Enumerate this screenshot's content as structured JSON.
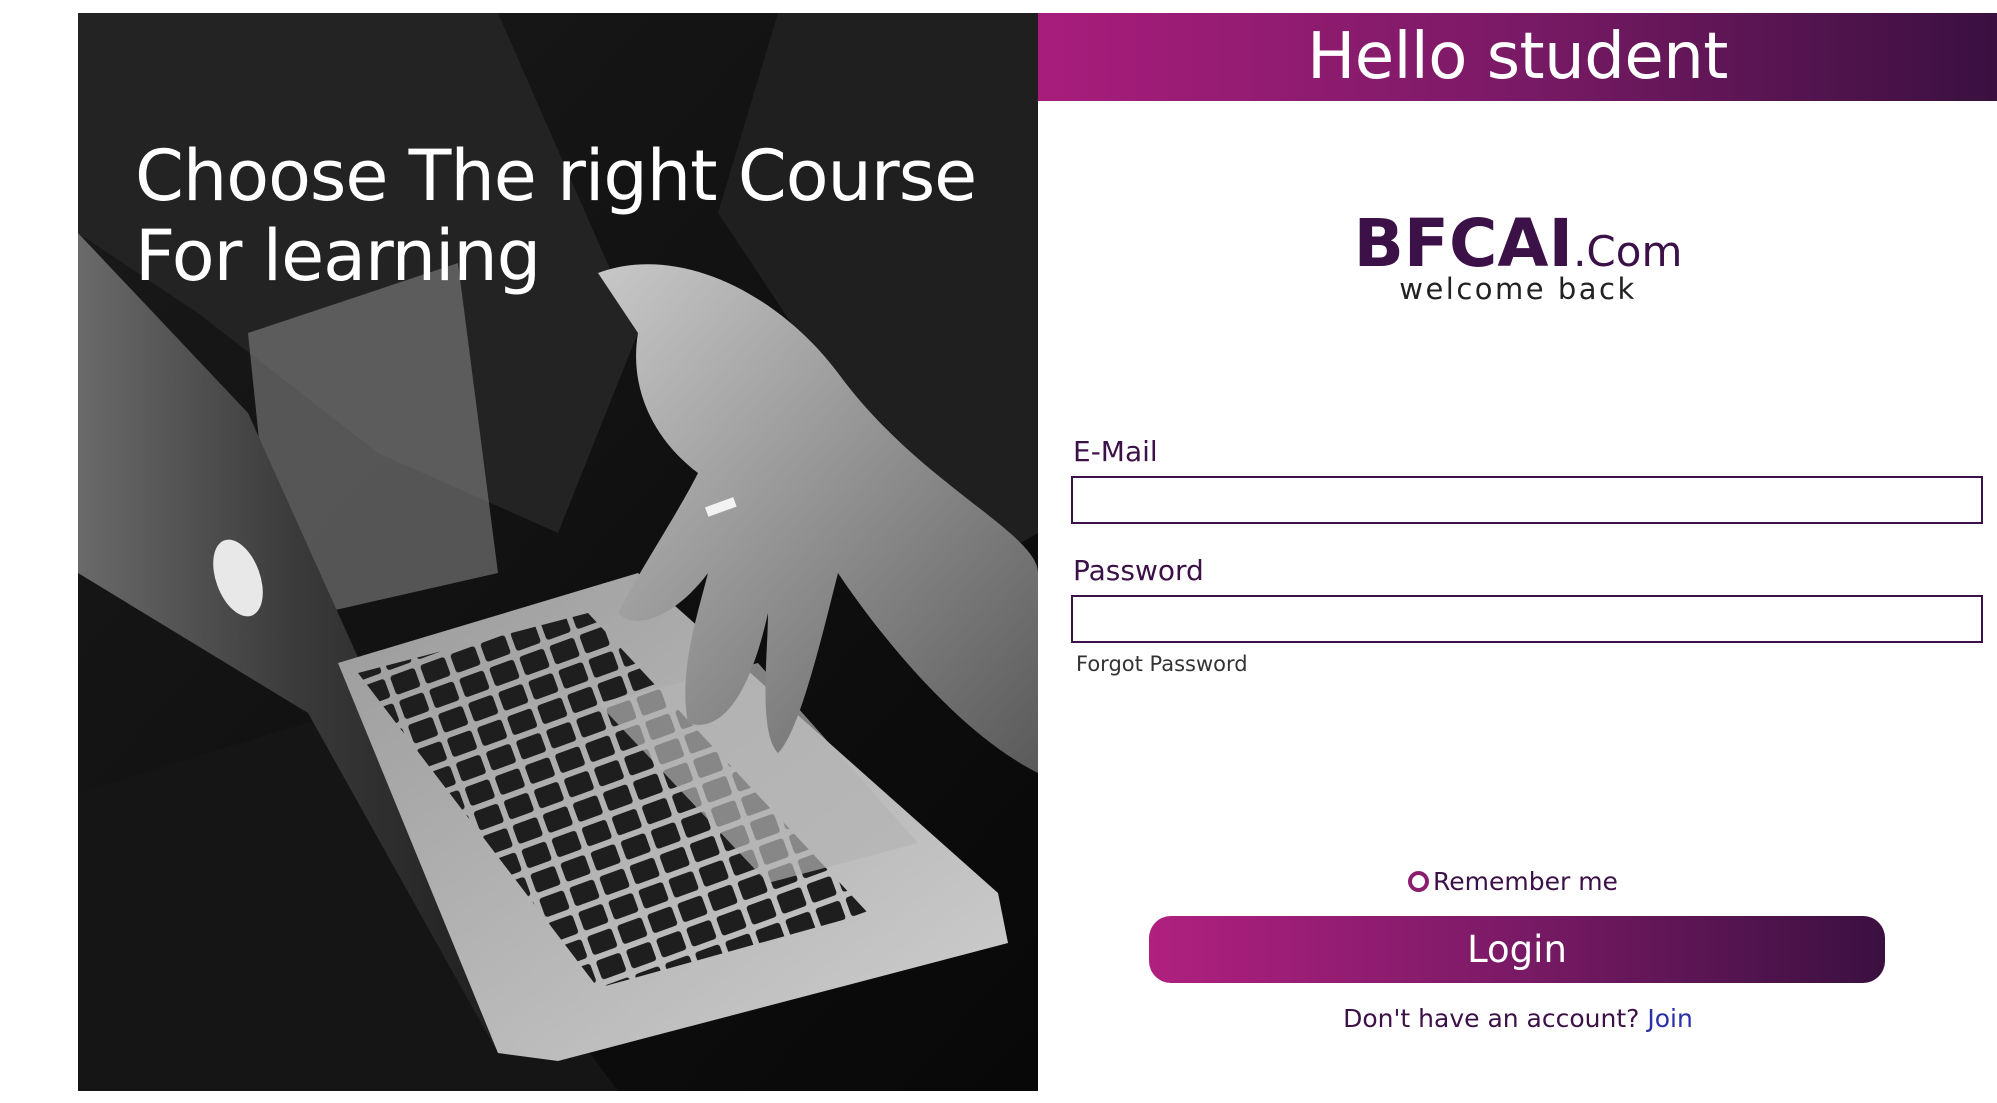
{
  "hero": {
    "title_line1": "Choose The right Course",
    "title_line2": "For learning",
    "image_description": ""
  },
  "header": {
    "title": "Hello student"
  },
  "brand": {
    "name": "BFCAI",
    "suffix": ".Com",
    "tagline": "welcome back"
  },
  "form": {
    "email_label": "E-Mail",
    "email_value": "",
    "password_label": "Password",
    "password_value": "",
    "forgot_link": "Forgot Password",
    "remember_label": "Remember me",
    "remember_checked": false,
    "login_button": "Login",
    "signup_prompt": "Don't have an account?",
    "signup_link": "Join"
  },
  "colors": {
    "accent_start": "#a81d7b",
    "accent_end": "#3a1040",
    "brand_text": "#3c1147",
    "link": "#2b2fa8"
  }
}
